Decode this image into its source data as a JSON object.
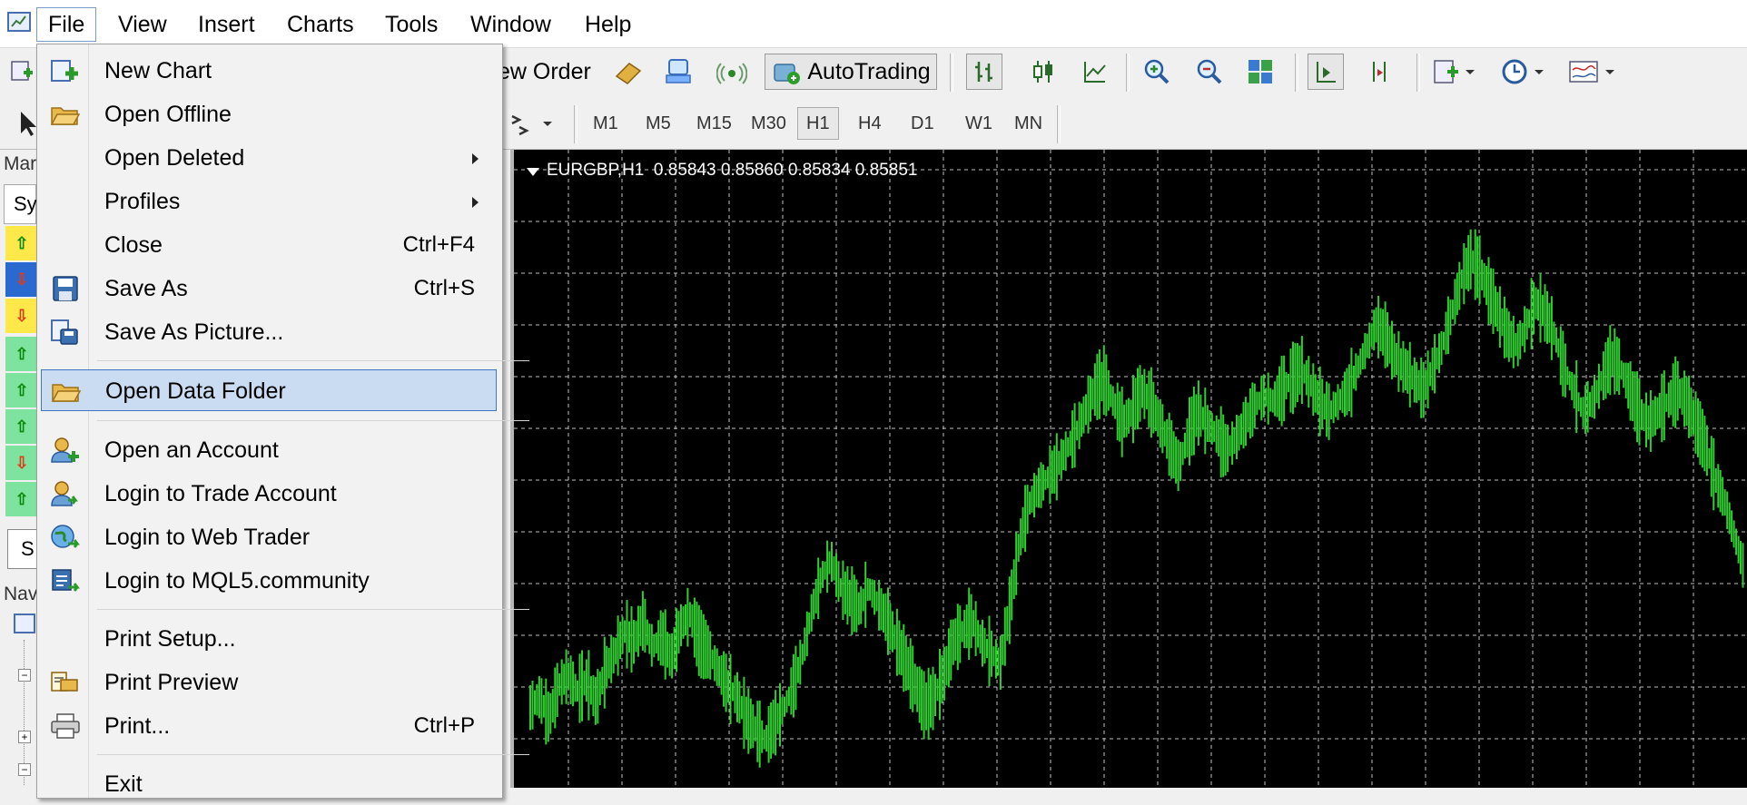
{
  "menubar": {
    "app_icon": "mt4-app-icon",
    "items": [
      {
        "label": "File",
        "open": true
      },
      {
        "label": "View"
      },
      {
        "label": "Insert"
      },
      {
        "label": "Charts"
      },
      {
        "label": "Tools"
      },
      {
        "label": "Window"
      },
      {
        "label": "Help"
      }
    ]
  },
  "toolbar": {
    "new_order_label": "ew Order",
    "autotrading_label": "AutoTrading",
    "timeframes": [
      "M1",
      "M5",
      "M15",
      "M30",
      "H1",
      "H4",
      "D1",
      "W1",
      "MN"
    ],
    "selected_timeframe": "H1"
  },
  "left_panels": {
    "market_watch_title": "Mar",
    "symbol_header": "Sy",
    "nav_title": "Nav",
    "tab_fragment": "S",
    "rows": [
      "up",
      "down",
      "down",
      "up",
      "up",
      "up",
      "down",
      "up"
    ]
  },
  "file_menu": {
    "items": [
      {
        "label": "New Chart",
        "icon": "new-chart-icon"
      },
      {
        "label": "Open Offline",
        "icon": "open-folder-icon"
      },
      {
        "label": "Open Deleted",
        "submenu": true
      },
      {
        "label": "Profiles",
        "submenu": true
      },
      {
        "label": "Close",
        "shortcut": "Ctrl+F4"
      },
      {
        "label": "Save As",
        "shortcut": "Ctrl+S",
        "icon": "floppy-disk-icon"
      },
      {
        "label": "Save As Picture...",
        "icon": "save-picture-icon"
      },
      {
        "label": "Open Data Folder",
        "icon": "folder-icon",
        "highlighted": true
      },
      {
        "label": "Open an Account",
        "icon": "add-account-icon"
      },
      {
        "label": "Login to Trade Account",
        "icon": "login-account-icon"
      },
      {
        "label": "Login to Web Trader",
        "icon": "web-trader-icon"
      },
      {
        "label": "Login to MQL5.community",
        "icon": "mql5-login-icon"
      },
      {
        "label": "Print Setup..."
      },
      {
        "label": "Print Preview",
        "icon": "print-preview-icon"
      },
      {
        "label": "Print...",
        "shortcut": "Ctrl+P",
        "icon": "printer-icon"
      },
      {
        "label": "Exit"
      }
    ]
  },
  "chart": {
    "symbol_line": "EURGBP,H1  0.85843 0.85860 0.85834 0.85851",
    "background_color": "#000000",
    "bar_color": "#32cd32",
    "grid_color": "#c0c0c0"
  },
  "chart_data": {
    "type": "ohlc",
    "title": "EURGBP,H1  0.85843 0.85860 0.85834 0.85851",
    "grid": true,
    "points_per_bar": "high-low",
    "values_relative_0_to_1": [
      0.08,
      0.1,
      0.06,
      0.12,
      0.14,
      0.11,
      0.13,
      0.09,
      0.15,
      0.18,
      0.22,
      0.2,
      0.24,
      0.19,
      0.21,
      0.17,
      0.23,
      0.25,
      0.2,
      0.18,
      0.15,
      0.12,
      0.1,
      0.06,
      0.04,
      0.02,
      0.05,
      0.08,
      0.12,
      0.18,
      0.26,
      0.32,
      0.35,
      0.3,
      0.28,
      0.26,
      0.3,
      0.27,
      0.24,
      0.2,
      0.16,
      0.12,
      0.08,
      0.1,
      0.14,
      0.2,
      0.22,
      0.24,
      0.2,
      0.18,
      0.16,
      0.26,
      0.38,
      0.45,
      0.48,
      0.5,
      0.52,
      0.55,
      0.58,
      0.62,
      0.66,
      0.68,
      0.64,
      0.6,
      0.62,
      0.66,
      0.64,
      0.6,
      0.56,
      0.52,
      0.58,
      0.62,
      0.6,
      0.58,
      0.55,
      0.57,
      0.6,
      0.63,
      0.65,
      0.64,
      0.66,
      0.68,
      0.7,
      0.67,
      0.64,
      0.62,
      0.64,
      0.66,
      0.7,
      0.74,
      0.78,
      0.76,
      0.72,
      0.7,
      0.68,
      0.66,
      0.7,
      0.74,
      0.8,
      0.86,
      0.9,
      0.88,
      0.84,
      0.8,
      0.76,
      0.74,
      0.78,
      0.82,
      0.8,
      0.76,
      0.7,
      0.66,
      0.62,
      0.64,
      0.68,
      0.72,
      0.7,
      0.66,
      0.62,
      0.6,
      0.62,
      0.64,
      0.66,
      0.64,
      0.6,
      0.56,
      0.5,
      0.46,
      0.4,
      0.34
    ]
  }
}
